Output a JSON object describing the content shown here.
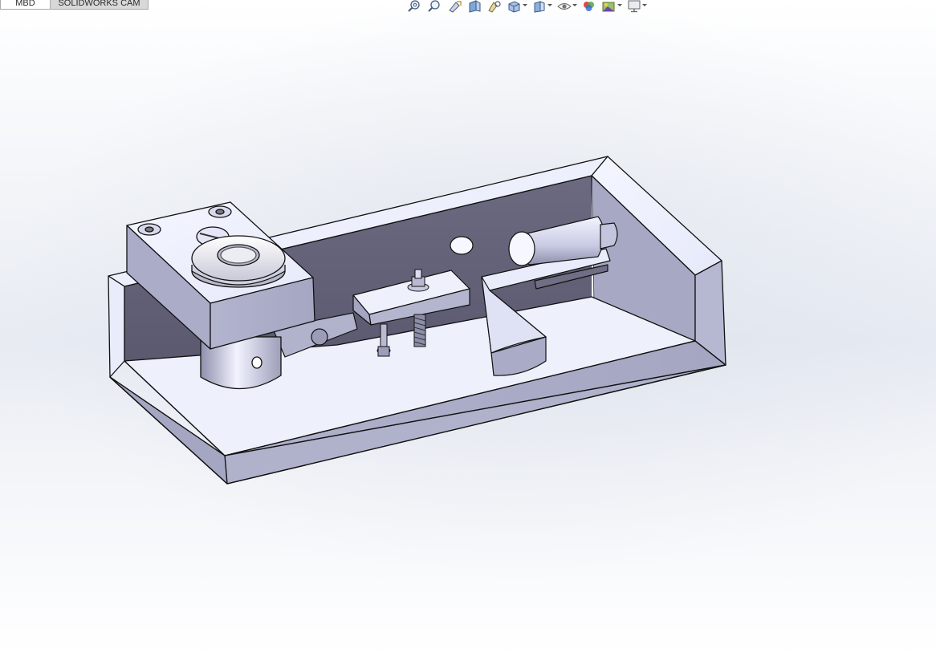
{
  "tabs": [
    {
      "label": "MBD",
      "active": true
    },
    {
      "label": "SOLIDWORKS CAM",
      "active": false
    }
  ],
  "view_toolbar": [
    {
      "icon": "zoom-to-fit-icon"
    },
    {
      "icon": "zoom-to-area-icon"
    },
    {
      "icon": "previous-view-icon"
    },
    {
      "icon": "section-view-icon"
    },
    {
      "icon": "dynamic-annotation-views-icon"
    },
    {
      "icon": "view-orientation-icon",
      "dropdown": true
    },
    {
      "icon": "display-style-icon",
      "dropdown": true
    },
    {
      "icon": "hide-show-items-icon",
      "dropdown": true
    },
    {
      "icon": "edit-appearance-icon"
    },
    {
      "icon": "apply-scene-icon",
      "dropdown": true
    },
    {
      "icon": "view-settings-icon",
      "dropdown": true
    }
  ],
  "colors": {
    "part_face_light": "#eef0fb",
    "part_face_mid": "#aeb0c9",
    "part_face_dark": "#5f5e73",
    "edge": "#111111"
  }
}
